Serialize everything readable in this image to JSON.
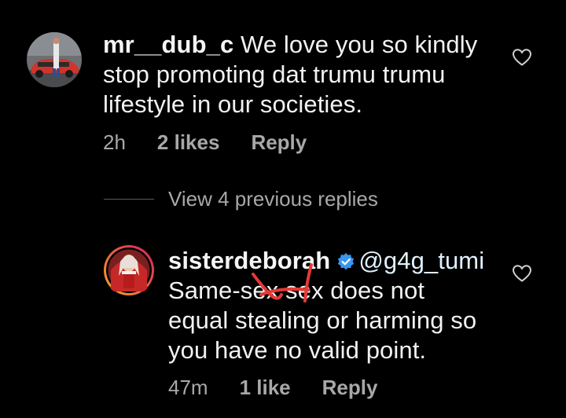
{
  "comment1": {
    "username": "mr__dub_c",
    "text_line1": " We love you so kindly",
    "text_line2": "stop promoting  dat trumu trumu",
    "text_line3": "lifestyle in our societies.",
    "time": "2h",
    "likes": "2 likes",
    "reply_label": "Reply",
    "icons": {
      "avatar": "avatar-car-photo",
      "like": "heart-outline-icon"
    }
  },
  "view_replies": {
    "label": "View 4 previous replies"
  },
  "comment2": {
    "username": "sisterdeborah",
    "mention": "@g4g_tumi",
    "text_line1": "Same-sex sex does not",
    "text_line2": "equal stealing or harming so",
    "text_line3": "you have no valid point.",
    "time": "47m",
    "likes": "1 like",
    "reply_label": "Reply",
    "icons": {
      "avatar": "avatar-story-ring",
      "verified": "verified-badge-icon",
      "like": "heart-outline-icon"
    },
    "colors": {
      "verified": "#3897f0",
      "story_ring_start": "#f9a825",
      "story_ring_end": "#d81b60",
      "scribble": "#e53935"
    }
  }
}
